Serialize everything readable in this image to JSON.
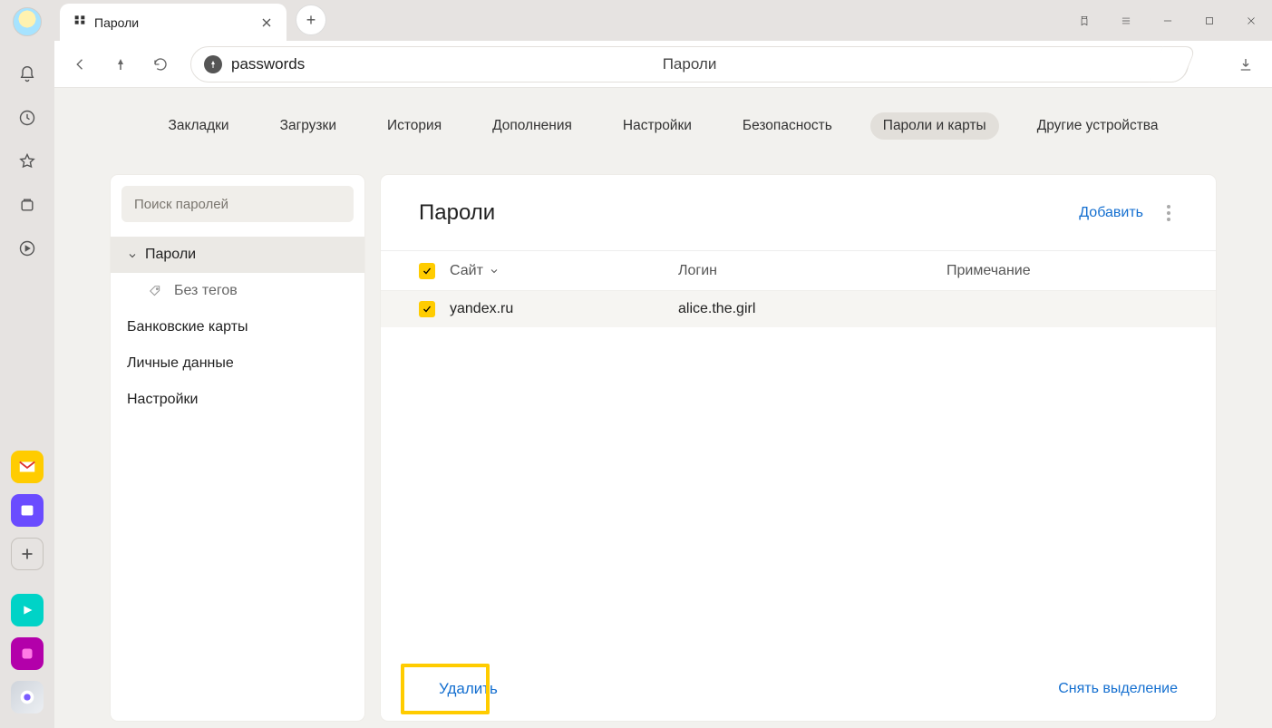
{
  "tab": {
    "title": "Пароли"
  },
  "omnibox": {
    "text": "passwords",
    "center_label": "Пароли"
  },
  "topnav": {
    "items": [
      "Закладки",
      "Загрузки",
      "История",
      "Дополнения",
      "Настройки",
      "Безопасность",
      "Пароли и карты",
      "Другие устройства"
    ],
    "active_index": 6
  },
  "sidebar_panel": {
    "search_placeholder": "Поиск паролей",
    "items": {
      "passwords": "Пароли",
      "no_tags": "Без тегов",
      "cards": "Банковские карты",
      "personal": "Личные данные",
      "settings": "Настройки"
    }
  },
  "main_panel": {
    "title": "Пароли",
    "add_label": "Добавить",
    "columns": {
      "site": "Сайт",
      "login": "Логин",
      "note": "Примечание"
    },
    "rows": [
      {
        "site": "yandex.ru",
        "login": "alice.the.girl",
        "checked": true
      }
    ],
    "footer": {
      "delete": "Удалить",
      "unselect": "Снять выделение"
    }
  }
}
